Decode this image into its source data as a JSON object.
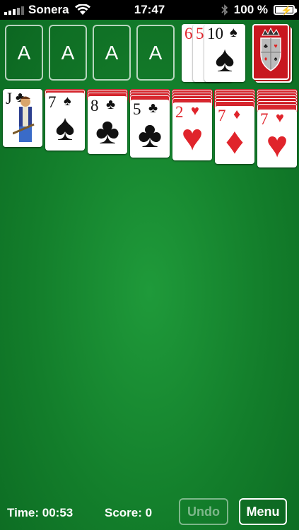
{
  "status_bar": {
    "carrier": "Sonera",
    "time": "17:47",
    "battery": "100 %"
  },
  "foundations": [
    "A",
    "A",
    "A",
    "A"
  ],
  "waste": [
    {
      "rank": "6",
      "suit": "♥",
      "color": "red"
    },
    {
      "rank": "5",
      "suit": "♥",
      "color": "red"
    },
    {
      "rank": "10",
      "suit": "♠",
      "color": "black"
    }
  ],
  "stock_icon": "crest-shield-icon",
  "tableau": [
    {
      "face_down": 0,
      "rank": "J",
      "suit": "♣",
      "color": "black"
    },
    {
      "face_down": 1,
      "rank": "7",
      "suit": "♠",
      "color": "black"
    },
    {
      "face_down": 2,
      "rank": "8",
      "suit": "♣",
      "color": "black"
    },
    {
      "face_down": 3,
      "rank": "5",
      "suit": "♣",
      "color": "black"
    },
    {
      "face_down": 4,
      "rank": "2",
      "suit": "♥",
      "color": "red"
    },
    {
      "face_down": 5,
      "rank": "7",
      "suit": "♦",
      "color": "red"
    },
    {
      "face_down": 6,
      "rank": "7",
      "suit": "♥",
      "color": "red"
    }
  ],
  "bottom_bar": {
    "time_label": "Time: 00:53",
    "score_label": "Score: 0",
    "undo_label": "Undo",
    "menu_label": "Menu"
  }
}
